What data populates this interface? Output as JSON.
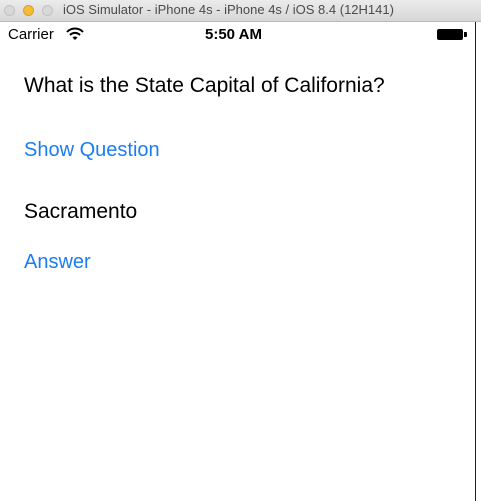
{
  "window": {
    "title": "iOS Simulator - iPhone 4s - iPhone 4s / iOS 8.4 (12H141)"
  },
  "statusbar": {
    "carrier": "Carrier",
    "time": "5:50 AM",
    "wifi_icon": "wifi-icon",
    "battery_icon": "battery-icon"
  },
  "main": {
    "question": "What is the State Capital of California?",
    "show_question_label": "Show Question",
    "answer": "Sacramento",
    "answer_label": "Answer"
  },
  "colors": {
    "tint": "#1a7df2",
    "text": "#000000",
    "background": "#ffffff"
  }
}
